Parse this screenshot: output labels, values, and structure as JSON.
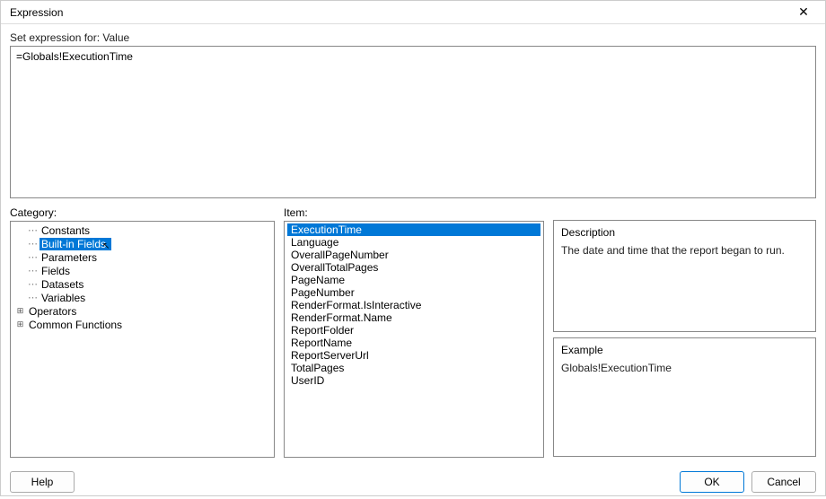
{
  "dialog": {
    "title": "Expression"
  },
  "subtitle": "Set expression for: Value",
  "expression": "=Globals!ExecutionTime",
  "labels": {
    "category": "Category:",
    "item": "Item:"
  },
  "category_tree": {
    "items": [
      {
        "label": "Constants",
        "expandable": false,
        "selected": false,
        "depth": 1
      },
      {
        "label": "Built-in Fields",
        "expandable": false,
        "selected": true,
        "depth": 1,
        "cursor": true
      },
      {
        "label": "Parameters",
        "expandable": false,
        "selected": false,
        "depth": 1
      },
      {
        "label": "Fields",
        "expandable": false,
        "selected": false,
        "depth": 1
      },
      {
        "label": "Datasets",
        "expandable": false,
        "selected": false,
        "depth": 1
      },
      {
        "label": "Variables",
        "expandable": false,
        "selected": false,
        "depth": 1
      },
      {
        "label": "Operators",
        "expandable": true,
        "selected": false,
        "depth": 0
      },
      {
        "label": "Common Functions",
        "expandable": true,
        "selected": false,
        "depth": 0
      }
    ]
  },
  "items_list": [
    {
      "label": "ExecutionTime",
      "selected": true
    },
    {
      "label": "Language",
      "selected": false
    },
    {
      "label": "OverallPageNumber",
      "selected": false
    },
    {
      "label": "OverallTotalPages",
      "selected": false
    },
    {
      "label": "PageName",
      "selected": false
    },
    {
      "label": "PageNumber",
      "selected": false
    },
    {
      "label": "RenderFormat.IsInteractive",
      "selected": false
    },
    {
      "label": "RenderFormat.Name",
      "selected": false
    },
    {
      "label": "ReportFolder",
      "selected": false
    },
    {
      "label": "ReportName",
      "selected": false
    },
    {
      "label": "ReportServerUrl",
      "selected": false
    },
    {
      "label": "TotalPages",
      "selected": false
    },
    {
      "label": "UserID",
      "selected": false
    }
  ],
  "description": {
    "label": "Description",
    "text": "The date and time that the report began to run."
  },
  "example": {
    "label": "Example",
    "text": "Globals!ExecutionTime"
  },
  "buttons": {
    "help": "Help",
    "ok": "OK",
    "cancel": "Cancel"
  }
}
